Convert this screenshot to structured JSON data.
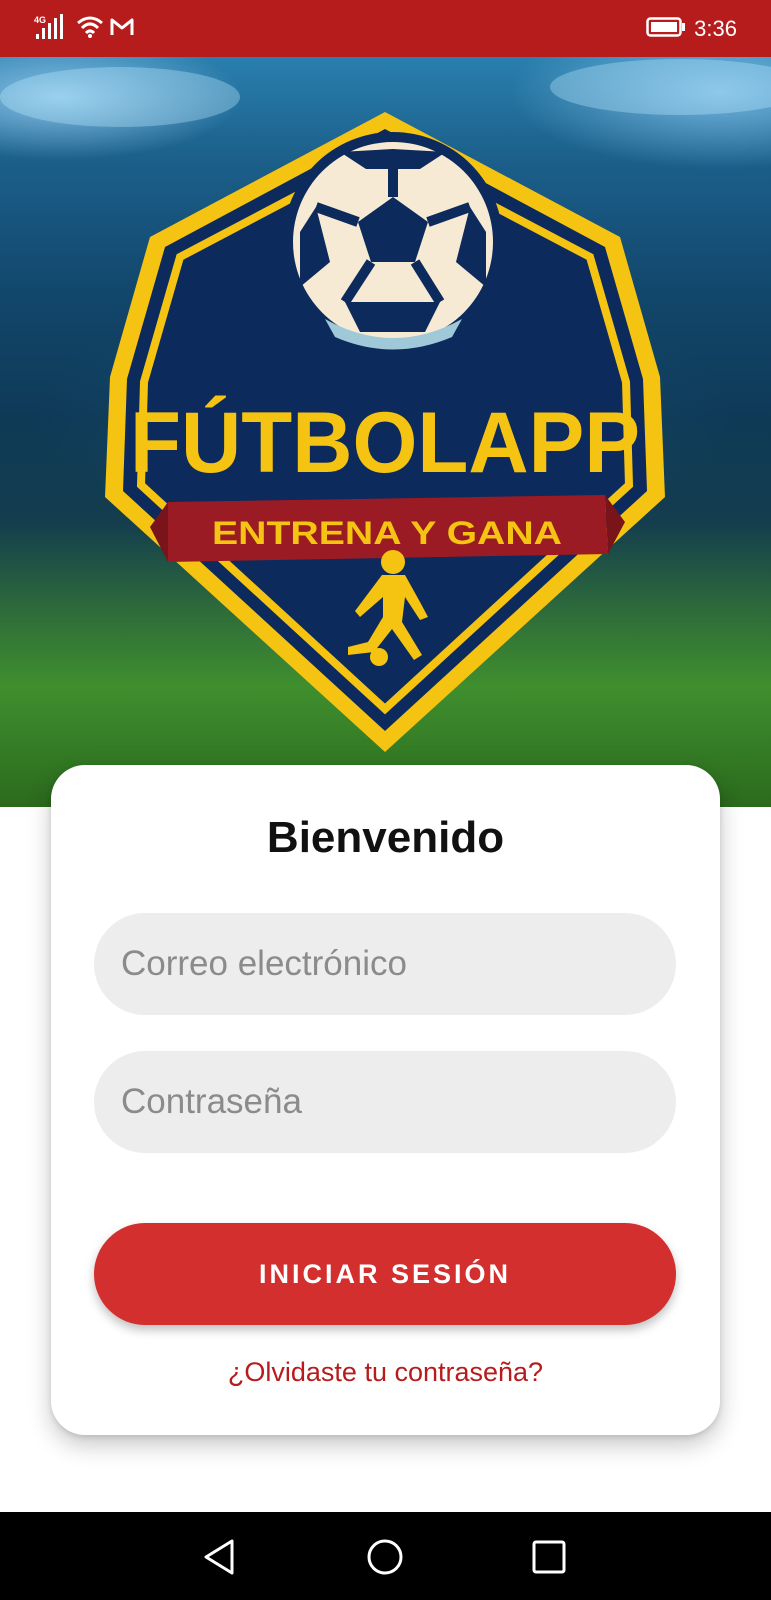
{
  "status_bar": {
    "network": "4G",
    "mail_icon": "gmail-icon",
    "time": "3:36",
    "color": "#b71c1c"
  },
  "logo": {
    "brand": "FÚTBOLAPP",
    "tagline": "ENTRENA Y GANA",
    "colors": {
      "shield": "#0d2a5c",
      "border": "#f5c311",
      "ribbon": "#9b1b24"
    }
  },
  "login": {
    "title": "Bienvenido",
    "email_placeholder": "Correo electrónico",
    "email_value": "",
    "password_placeholder": "Contraseña",
    "password_value": "",
    "submit_label": "INICIAR SESIÓN",
    "forgot_label": "¿Olvidaste tu contraseña?",
    "accent": "#d32f2f"
  },
  "nav_bar": {
    "back_icon": "triangle-back-icon",
    "home_icon": "circle-home-icon",
    "recents_icon": "square-recents-icon"
  }
}
